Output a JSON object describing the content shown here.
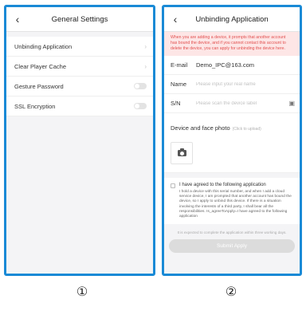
{
  "screen1": {
    "title": "General Settings",
    "back_icon": "chevron-left-icon",
    "items": [
      {
        "label": "Unbinding Application",
        "control": "chevron"
      },
      {
        "label": "Clear Player Cache",
        "control": "chevron"
      },
      {
        "label": "Gesture Password",
        "control": "toggle",
        "on": false
      },
      {
        "label": "SSL Encryption",
        "control": "toggle",
        "on": false
      }
    ]
  },
  "screen2": {
    "title": "Unbinding Application",
    "back_icon": "chevron-left-icon",
    "warning": "When you are adding a device, it prompts that another account has bound the device, and if you cannot contact this account to delete the device, you can apply for unbinding the device here.",
    "email": {
      "label": "E-mail",
      "value": "Demo_IPC@163.com"
    },
    "name": {
      "label": "Name",
      "placeholder": "Please input your real name"
    },
    "sn": {
      "label": "S/N",
      "placeholder": "Please scan the device label",
      "icon": "scan-icon"
    },
    "photo": {
      "title": "Device and face photo",
      "hint": "(Click to upload)",
      "icon": "camera-icon"
    },
    "agreement": {
      "checked": false,
      "title": "I have agreed to the following application",
      "body": "I hold a device with this serial number, and when I add a cloud service device, I am prompted that another account has bound the device, so I apply to unbind this device. If there is a situation involving the interests of a third party, I shall bear all the responsibilities. Is_agreeToApply=I have agreed to the following application"
    },
    "expected_note": "It is expected to complete the application within three working days.",
    "submit_label": "Submit Apply"
  },
  "captions": [
    "①",
    "②"
  ],
  "colors": {
    "frame": "#1a8ad6",
    "warning_bg": "#fde6e6",
    "warning_text": "#e2504f",
    "submit_disabled": "#dcdcdc"
  }
}
